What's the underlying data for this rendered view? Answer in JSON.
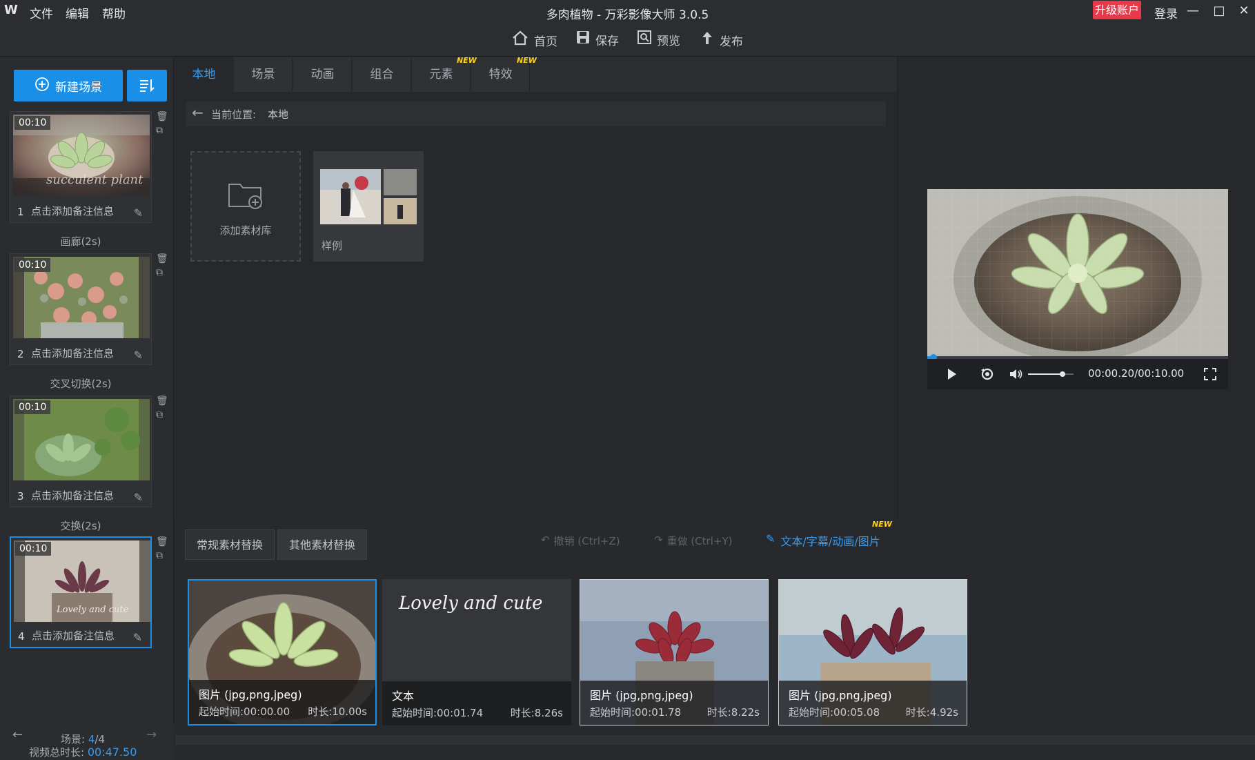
{
  "app": {
    "logo": "W",
    "menu": [
      "文件",
      "编辑",
      "帮助"
    ],
    "title": "多肉植物 - 万彩影像大师 3.0.5",
    "upgrade_label": "升级账户",
    "login_label": "登录",
    "window_buttons": [
      "—",
      "□",
      "✕"
    ]
  },
  "toolbar": {
    "items": [
      {
        "label": "首页",
        "icon": "home-icon"
      },
      {
        "label": "保存",
        "icon": "save-icon"
      },
      {
        "label": "预览",
        "icon": "preview-icon"
      },
      {
        "label": "发布",
        "icon": "publish-icon"
      }
    ]
  },
  "sidebar": {
    "new_scene_label": "新建场景",
    "scenes": [
      {
        "num": "1",
        "duration": "00:10",
        "note": "点击添加备注信息",
        "transition": "画廊(2s)"
      },
      {
        "num": "2",
        "duration": "00:10",
        "note": "点击添加备注信息",
        "transition": "交叉切换(2s)"
      },
      {
        "num": "3",
        "duration": "00:10",
        "note": "点击添加备注信息",
        "transition": "交换(2s)"
      },
      {
        "num": "4",
        "duration": "00:10",
        "note": "点击添加备注信息",
        "transition": ""
      }
    ],
    "scene_count_label": "场景:",
    "scene_count_current": "4",
    "scene_count_sep": "/",
    "scene_count_total": "4",
    "total_duration_label": "视频总时长:",
    "total_duration": "00:47.50"
  },
  "library": {
    "tabs": [
      {
        "label": "本地",
        "active": true,
        "new": false
      },
      {
        "label": "场景",
        "active": false,
        "new": false
      },
      {
        "label": "动画",
        "active": false,
        "new": false
      },
      {
        "label": "组合",
        "active": false,
        "new": false
      },
      {
        "label": "元素",
        "active": false,
        "new": true
      },
      {
        "label": "特效",
        "active": false,
        "new": true
      }
    ],
    "new_tag": "NEW",
    "path_label": "当前位置:",
    "path_value": "本地",
    "search_placeholder": "",
    "add_library_label": "添加素材库",
    "sample_folder_label": "样例"
  },
  "player": {
    "time": "00:00.20/00:10.00",
    "progress": 0.02,
    "volume": 0.75
  },
  "bottom": {
    "tabs": [
      "常规素材替换",
      "其他素材替换"
    ],
    "undo_label": "撤销 (Ctrl+Z)",
    "redo_label": "重做 (Ctrl+Y)",
    "text_link_label": "文本/字幕/动画/图片",
    "new_tag": "NEW",
    "clips": [
      {
        "type": "图片 (jpg,png,jpeg)",
        "start": "起始时间:00:00.00",
        "duration": "时长:10.00s",
        "selected": true
      },
      {
        "type": "文本",
        "start": "起始时间:00:01.74",
        "duration": "时长:8.26s",
        "text_preview": "Lovely and cute",
        "selected": false
      },
      {
        "type": "图片 (jpg,png,jpeg)",
        "start": "起始时间:00:01.78",
        "duration": "时长:8.22s",
        "selected": false
      },
      {
        "type": "图片 (jpg,png,jpeg)",
        "start": "起始时间:00:05.08",
        "duration": "时长:4.92s",
        "selected": false
      }
    ]
  },
  "colors": {
    "accent": "#1a8fe8",
    "upgrade": "#e8394b",
    "new_tag": "#ffd21a"
  }
}
